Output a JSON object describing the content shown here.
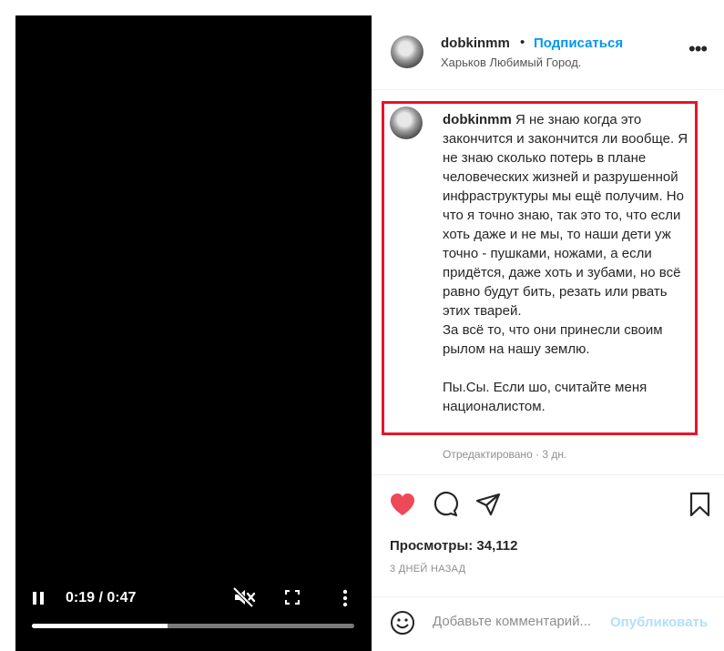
{
  "video": {
    "time": "0:19 / 0:47",
    "progress_fraction": 0.42,
    "icons": [
      "pause-icon",
      "muted-icon",
      "fullscreen-icon",
      "more-vertical-icon"
    ]
  },
  "header": {
    "username": "dobkinmm",
    "dot": "•",
    "follow_label": "Подписаться",
    "location": "Харьков Любимый Город.",
    "more_label": "•••"
  },
  "caption": {
    "username": "dobkinmm",
    "text": " Я не знаю когда это закончится и закончится ли вообще. Я не знаю сколько потерь в плане человеческих жизней и разрушенной инфраструктуры мы ещё получим. Но что я точно знаю, так это то, что если хоть даже и не мы, то наши дети уж точно - пушками, ножами, а если придётся, даже хоть и зубами, но всё равно будут бить, резать или рвать этих тварей.\nЗа всё то, что они принесли своим рылом на нашу землю.\n\nПы.Сы. Если шо, считайте меня националистом.",
    "edited": "Отредактировано · 3 дн."
  },
  "actions": {
    "icons": [
      "heart-icon",
      "comment-icon",
      "share-icon",
      "bookmark-icon"
    ],
    "like_color": "#ed4956"
  },
  "stats": {
    "views": "Просмотры: 34,112",
    "date": "3 ДНЕЙ НАЗАД"
  },
  "comment": {
    "placeholder": "Добавьте комментарий...",
    "publish_label": "Опубликовать"
  },
  "colors": {
    "accent": "#0095f6",
    "highlight_border": "#e8142a",
    "publish_disabled": "#b2dffc"
  }
}
